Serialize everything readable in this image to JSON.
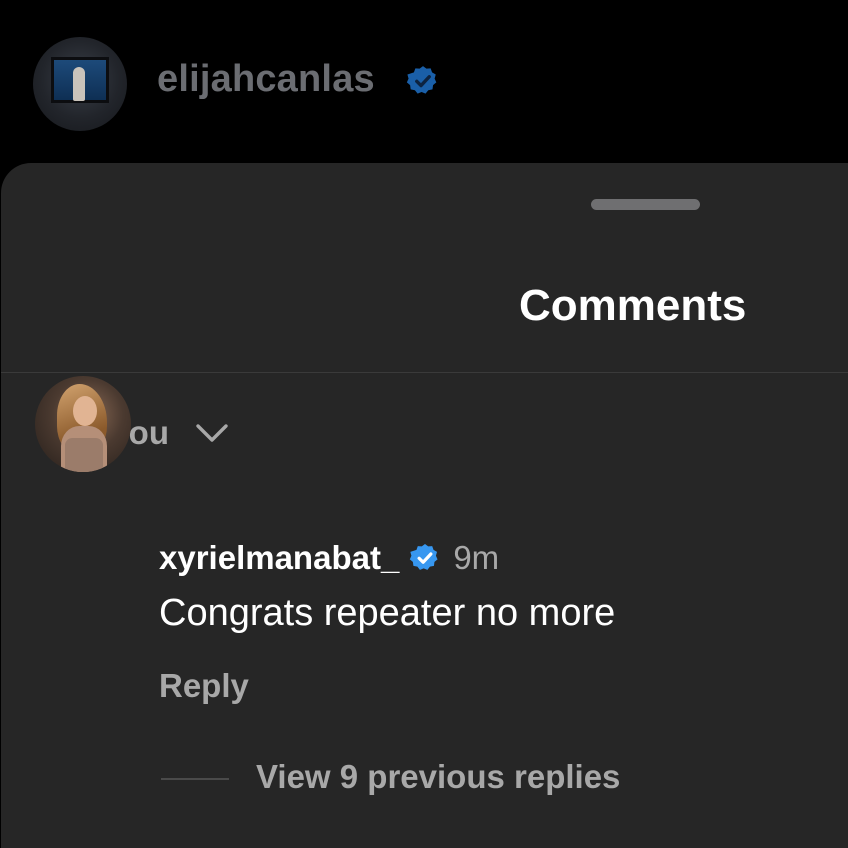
{
  "post_header": {
    "username": "elijahcanlas",
    "verified": true,
    "avatar_icon": "user-avatar-icon"
  },
  "comments_sheet": {
    "title": "Comments",
    "sort_label": "For you",
    "sort_icon": "chevron-down-icon"
  },
  "comment": {
    "username": "xyrielmanabat_",
    "verified": true,
    "time_ago": "9m",
    "text": "Congrats repeater no more",
    "reply_label": "Reply",
    "view_replies_label": "View 9 previous replies"
  },
  "colors": {
    "background": "#000000",
    "sheet": "#262626",
    "verified_badge": "#3797f0",
    "secondary_text": "#a8a8a8",
    "primary_text": "#ffffff"
  }
}
